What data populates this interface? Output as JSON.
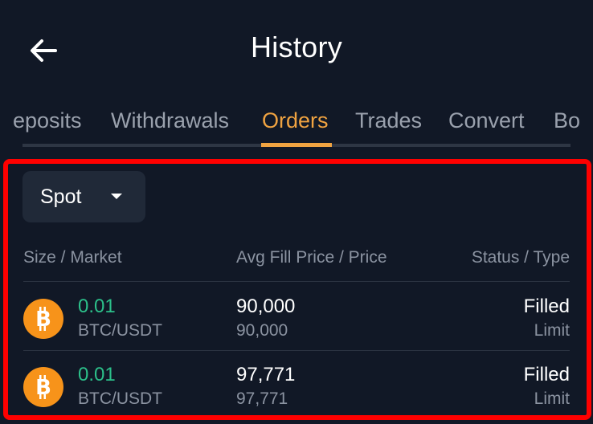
{
  "header": {
    "title": "History",
    "back_icon": "arrow-left-icon"
  },
  "tabs": [
    {
      "label": "eposits",
      "active": false
    },
    {
      "label": "Withdrawals",
      "active": false
    },
    {
      "label": "Orders",
      "active": true
    },
    {
      "label": "Trades",
      "active": false
    },
    {
      "label": "Convert",
      "active": false
    },
    {
      "label": "Bo",
      "active": false
    }
  ],
  "filter": {
    "market_type": "Spot",
    "caret_icon": "caret-down-icon"
  },
  "table": {
    "columns": [
      "Size / Market",
      "Avg Fill Price / Price",
      "Status / Type"
    ],
    "rows": [
      {
        "icon": "bitcoin-icon",
        "size": "0.01",
        "market": "BTC/USDT",
        "avg_fill_price": "90,000",
        "price": "90,000",
        "status": "Filled",
        "type": "Limit"
      },
      {
        "icon": "bitcoin-icon",
        "size": "0.01",
        "market": "BTC/USDT",
        "avg_fill_price": "97,771",
        "price": "97,771",
        "status": "Filled",
        "type": "Limit"
      }
    ]
  },
  "colors": {
    "background": "#111826",
    "accent": "#f0a341",
    "positive": "#2cc08a",
    "highlight": "#ff0000",
    "bitcoin": "#f7931a"
  }
}
